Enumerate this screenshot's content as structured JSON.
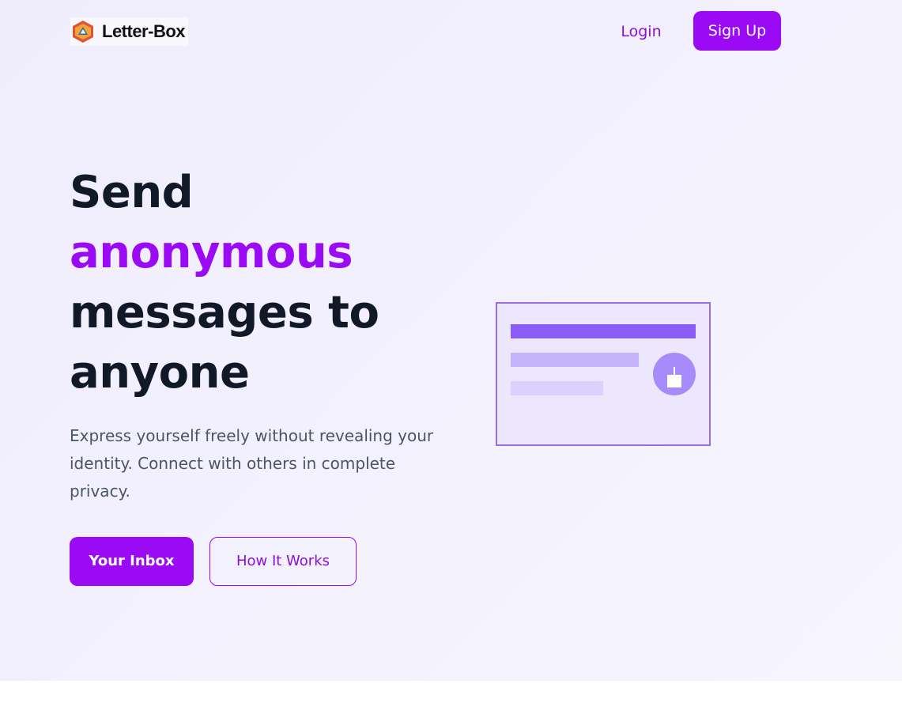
{
  "brand": {
    "name": "Letter-Box",
    "logo_colors": [
      "#e0523a",
      "#f2a33a",
      "#2a6f8f"
    ]
  },
  "nav": {
    "login_label": "Login",
    "signup_label": "Sign Up"
  },
  "hero": {
    "headline_line1": "Send",
    "headline_accent": "anonymous",
    "headline_line3": "messages to",
    "headline_line4": "anyone",
    "subtext": "Express yourself freely without revealing your identity. Connect with others in complete privacy.",
    "primary_button": "Your Inbox",
    "secondary_button": "How It Works"
  },
  "illustration": {
    "icon": "message-card-illustration"
  },
  "colors": {
    "accent": "#9a0af5",
    "heading": "#111827",
    "body_text": "#4b5563",
    "background": "#f1effc"
  }
}
